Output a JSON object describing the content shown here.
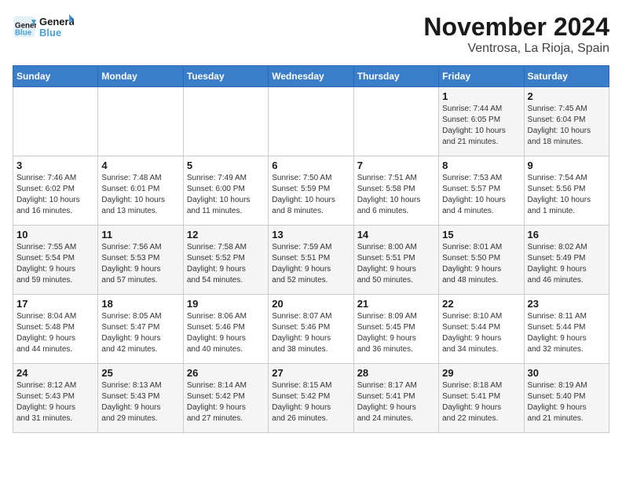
{
  "header": {
    "logo_line1": "General",
    "logo_line2": "Blue",
    "month": "November 2024",
    "location": "Ventrosa, La Rioja, Spain"
  },
  "weekdays": [
    "Sunday",
    "Monday",
    "Tuesday",
    "Wednesday",
    "Thursday",
    "Friday",
    "Saturday"
  ],
  "weeks": [
    [
      {
        "day": "",
        "info": ""
      },
      {
        "day": "",
        "info": ""
      },
      {
        "day": "",
        "info": ""
      },
      {
        "day": "",
        "info": ""
      },
      {
        "day": "",
        "info": ""
      },
      {
        "day": "1",
        "info": "Sunrise: 7:44 AM\nSunset: 6:05 PM\nDaylight: 10 hours\nand 21 minutes."
      },
      {
        "day": "2",
        "info": "Sunrise: 7:45 AM\nSunset: 6:04 PM\nDaylight: 10 hours\nand 18 minutes."
      }
    ],
    [
      {
        "day": "3",
        "info": "Sunrise: 7:46 AM\nSunset: 6:02 PM\nDaylight: 10 hours\nand 16 minutes."
      },
      {
        "day": "4",
        "info": "Sunrise: 7:48 AM\nSunset: 6:01 PM\nDaylight: 10 hours\nand 13 minutes."
      },
      {
        "day": "5",
        "info": "Sunrise: 7:49 AM\nSunset: 6:00 PM\nDaylight: 10 hours\nand 11 minutes."
      },
      {
        "day": "6",
        "info": "Sunrise: 7:50 AM\nSunset: 5:59 PM\nDaylight: 10 hours\nand 8 minutes."
      },
      {
        "day": "7",
        "info": "Sunrise: 7:51 AM\nSunset: 5:58 PM\nDaylight: 10 hours\nand 6 minutes."
      },
      {
        "day": "8",
        "info": "Sunrise: 7:53 AM\nSunset: 5:57 PM\nDaylight: 10 hours\nand 4 minutes."
      },
      {
        "day": "9",
        "info": "Sunrise: 7:54 AM\nSunset: 5:56 PM\nDaylight: 10 hours\nand 1 minute."
      }
    ],
    [
      {
        "day": "10",
        "info": "Sunrise: 7:55 AM\nSunset: 5:54 PM\nDaylight: 9 hours\nand 59 minutes."
      },
      {
        "day": "11",
        "info": "Sunrise: 7:56 AM\nSunset: 5:53 PM\nDaylight: 9 hours\nand 57 minutes."
      },
      {
        "day": "12",
        "info": "Sunrise: 7:58 AM\nSunset: 5:52 PM\nDaylight: 9 hours\nand 54 minutes."
      },
      {
        "day": "13",
        "info": "Sunrise: 7:59 AM\nSunset: 5:51 PM\nDaylight: 9 hours\nand 52 minutes."
      },
      {
        "day": "14",
        "info": "Sunrise: 8:00 AM\nSunset: 5:51 PM\nDaylight: 9 hours\nand 50 minutes."
      },
      {
        "day": "15",
        "info": "Sunrise: 8:01 AM\nSunset: 5:50 PM\nDaylight: 9 hours\nand 48 minutes."
      },
      {
        "day": "16",
        "info": "Sunrise: 8:02 AM\nSunset: 5:49 PM\nDaylight: 9 hours\nand 46 minutes."
      }
    ],
    [
      {
        "day": "17",
        "info": "Sunrise: 8:04 AM\nSunset: 5:48 PM\nDaylight: 9 hours\nand 44 minutes."
      },
      {
        "day": "18",
        "info": "Sunrise: 8:05 AM\nSunset: 5:47 PM\nDaylight: 9 hours\nand 42 minutes."
      },
      {
        "day": "19",
        "info": "Sunrise: 8:06 AM\nSunset: 5:46 PM\nDaylight: 9 hours\nand 40 minutes."
      },
      {
        "day": "20",
        "info": "Sunrise: 8:07 AM\nSunset: 5:46 PM\nDaylight: 9 hours\nand 38 minutes."
      },
      {
        "day": "21",
        "info": "Sunrise: 8:09 AM\nSunset: 5:45 PM\nDaylight: 9 hours\nand 36 minutes."
      },
      {
        "day": "22",
        "info": "Sunrise: 8:10 AM\nSunset: 5:44 PM\nDaylight: 9 hours\nand 34 minutes."
      },
      {
        "day": "23",
        "info": "Sunrise: 8:11 AM\nSunset: 5:44 PM\nDaylight: 9 hours\nand 32 minutes."
      }
    ],
    [
      {
        "day": "24",
        "info": "Sunrise: 8:12 AM\nSunset: 5:43 PM\nDaylight: 9 hours\nand 31 minutes."
      },
      {
        "day": "25",
        "info": "Sunrise: 8:13 AM\nSunset: 5:43 PM\nDaylight: 9 hours\nand 29 minutes."
      },
      {
        "day": "26",
        "info": "Sunrise: 8:14 AM\nSunset: 5:42 PM\nDaylight: 9 hours\nand 27 minutes."
      },
      {
        "day": "27",
        "info": "Sunrise: 8:15 AM\nSunset: 5:42 PM\nDaylight: 9 hours\nand 26 minutes."
      },
      {
        "day": "28",
        "info": "Sunrise: 8:17 AM\nSunset: 5:41 PM\nDaylight: 9 hours\nand 24 minutes."
      },
      {
        "day": "29",
        "info": "Sunrise: 8:18 AM\nSunset: 5:41 PM\nDaylight: 9 hours\nand 22 minutes."
      },
      {
        "day": "30",
        "info": "Sunrise: 8:19 AM\nSunset: 5:40 PM\nDaylight: 9 hours\nand 21 minutes."
      }
    ]
  ]
}
